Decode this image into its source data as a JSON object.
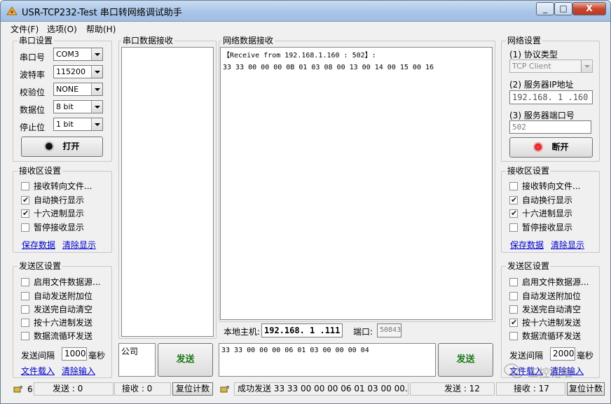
{
  "window": {
    "title": "USR-TCP232-Test 串口转网络调试助手",
    "minimize": "_",
    "maximize": "□",
    "close": "X"
  },
  "menu": [
    "文件(F)",
    "选项(O)",
    "帮助(H)"
  ],
  "serial_settings": {
    "title": "串口设置",
    "port_label": "串口号",
    "port_value": "COM3",
    "baud_label": "波特率",
    "baud_value": "115200",
    "parity_label": "校验位",
    "parity_value": "NONE",
    "data_label": "数据位",
    "data_value": "8 bit",
    "stop_label": "停止位",
    "stop_value": "1 bit",
    "open_button": "打开"
  },
  "left_receive": {
    "title": "接收区设置",
    "options": [
      {
        "label": "接收转向文件...",
        "checked": false
      },
      {
        "label": "自动换行显示",
        "checked": true
      },
      {
        "label": "十六进制显示",
        "checked": true
      },
      {
        "label": "暂停接收显示",
        "checked": false
      }
    ],
    "save_link": "保存数据",
    "clear_link": "清除显示"
  },
  "left_send": {
    "title": "发送区设置",
    "options": [
      {
        "label": "启用文件数据源...",
        "checked": false
      },
      {
        "label": "自动发送附加位",
        "checked": false
      },
      {
        "label": "发送完自动清空",
        "checked": false
      },
      {
        "label": "按十六进制发送",
        "checked": false
      },
      {
        "label": "数据流循环发送",
        "checked": false
      }
    ],
    "interval_label": "发送间隔",
    "interval_value": "1000",
    "interval_unit": "毫秒",
    "load_link": "文件载入",
    "clear_link": "清除输入"
  },
  "serial_receive": {
    "title": "串口数据接收",
    "content": ""
  },
  "serial_send": {
    "input_value": "公司",
    "send_button": "发送"
  },
  "network_receive": {
    "title": "网络数据接收",
    "line1": "【Receive from 192.168.1.160 : 502】:",
    "line2": "33 33 00 00 00 0B 01 03 08 00 13 00 14 00 15 00 16"
  },
  "local_host": {
    "label": "本地主机:",
    "ip": "192.168. 1 .111",
    "port_label": "端口:",
    "port_value": "50843"
  },
  "network_send": {
    "input_value": "33 33 00 00 00 06 01 03 00 00 00 04",
    "send_button": "发送"
  },
  "network_settings": {
    "title": "网络设置",
    "protocol_label": "(1) 协议类型",
    "protocol_value": "TCP Client",
    "ip_label": "(2) 服务器IP地址",
    "ip_value": "192.168. 1 .160",
    "port_label": "(3) 服务器端口号",
    "port_value": "502",
    "disconnect_button": "断开"
  },
  "right_receive": {
    "title": "接收区设置",
    "options": [
      {
        "label": "接收转向文件...",
        "checked": false
      },
      {
        "label": "自动换行显示",
        "checked": true
      },
      {
        "label": "十六进制显示",
        "checked": true
      },
      {
        "label": "暂停接收显示",
        "checked": false
      }
    ],
    "save_link": "保存数据",
    "clear_link": "清除显示"
  },
  "right_send": {
    "title": "发送区设置",
    "options": [
      {
        "label": "启用文件数据源...",
        "checked": false
      },
      {
        "label": "自动发送附加位",
        "checked": false
      },
      {
        "label": "发送完自动清空",
        "checked": false
      },
      {
        "label": "按十六进制发送",
        "checked": true
      },
      {
        "label": "数据流循环发送",
        "checked": false
      }
    ],
    "interval_label": "发送间隔",
    "interval_value": "2000",
    "interval_unit": "毫秒",
    "load_link": "文件载入",
    "clear_link": "清除输入"
  },
  "status": {
    "left_num": "6",
    "left_send": "发送 : 0",
    "left_recv": "接收 : 0",
    "left_reset": "复位计数",
    "right_msg": "成功发送 33 33 00 00 00 06 01 03 00 00...",
    "right_send": "发送 : 12",
    "right_recv": "接收 : 17",
    "right_reset": "复位计数"
  },
  "watermark": "工控论坛",
  "colors": {
    "title_gradient": "#a9c6e8",
    "link": "#0000cc",
    "send_button_text": "#1a7a1a",
    "led_red": "#e00000"
  }
}
